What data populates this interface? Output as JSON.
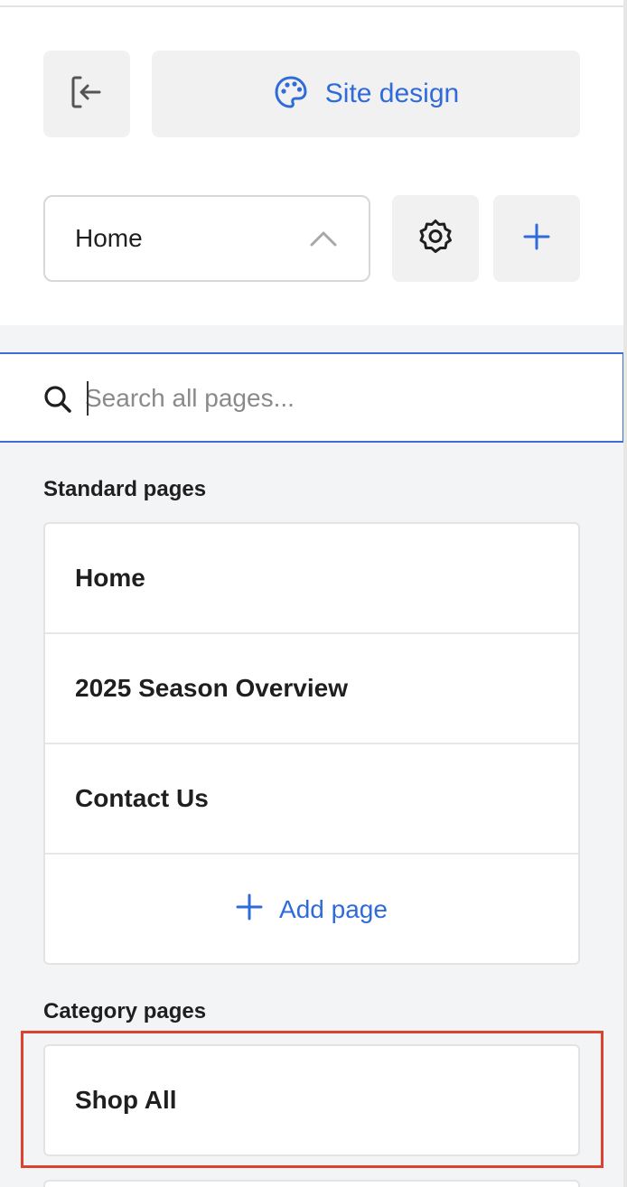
{
  "header": {
    "exit_icon": "exit-panel-icon",
    "site_design_label": "Site design",
    "site_design_icon": "palette-icon"
  },
  "page_selector": {
    "selected": "Home",
    "chevron_icon": "chevron-up-icon"
  },
  "toolbar": {
    "settings_icon": "gear-icon",
    "add_icon": "plus-icon"
  },
  "search": {
    "placeholder": "Search all pages...",
    "value": "",
    "icon": "search-icon"
  },
  "standard_pages": {
    "label": "Standard pages",
    "items": [
      {
        "label": "Home"
      },
      {
        "label": "2025 Season Overview"
      },
      {
        "label": "Contact Us"
      }
    ],
    "add_page_label": "Add page"
  },
  "category_pages": {
    "label": "Category pages",
    "items": [
      {
        "label": "Shop All"
      }
    ]
  },
  "colors": {
    "accent": "#2f6bd9",
    "highlight": "#d9432f",
    "panel_bg": "#f3f4f6"
  }
}
